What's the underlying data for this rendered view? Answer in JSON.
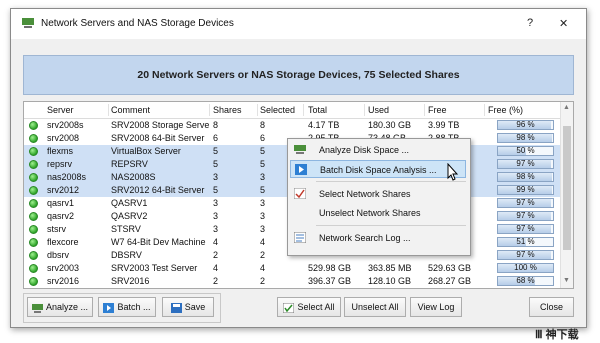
{
  "window": {
    "title": "Network Servers and NAS Storage Devices",
    "help_label": "?",
    "close_label": "✕"
  },
  "banner": {
    "text": "20 Network Servers or NAS Storage Devices, 75 Selected Shares"
  },
  "table": {
    "columns": [
      "Server",
      "Comment",
      "Shares",
      "Selected",
      "Total",
      "Used",
      "Free",
      "Free (%)"
    ],
    "rows": [
      {
        "server": "srv2008s",
        "comment": "SRV2008 Storage Server",
        "shares": "8",
        "selected": "8",
        "total": "4.17 TB",
        "used": "180.30 GB",
        "free": "3.99 TB",
        "free_pct": "96 %",
        "pct": 96,
        "selected_row": false
      },
      {
        "server": "srv2008",
        "comment": "SRV2008 64-Bit Server",
        "shares": "6",
        "selected": "6",
        "total": "2.95 TB",
        "used": "73.48 GB",
        "free": "2.88 TB",
        "free_pct": "98 %",
        "pct": 98,
        "selected_row": false
      },
      {
        "server": "flexms",
        "comment": "VirtualBox Server",
        "shares": "5",
        "selected": "5",
        "total": "",
        "used": "",
        "free": "",
        "free_pct": "50 %",
        "pct": 50,
        "selected_row": true
      },
      {
        "server": "repsrv",
        "comment": "REPSRV",
        "shares": "5",
        "selected": "5",
        "total": "",
        "used": "",
        "free": "",
        "free_pct": "97 %",
        "pct": 97,
        "selected_row": true
      },
      {
        "server": "nas2008s",
        "comment": "NAS2008S",
        "shares": "3",
        "selected": "3",
        "total": "",
        "used": "",
        "free": "",
        "free_pct": "98 %",
        "pct": 98,
        "selected_row": true
      },
      {
        "server": "srv2012",
        "comment": "SRV2012 64-Bit Server",
        "shares": "5",
        "selected": "5",
        "total": "",
        "used": "",
        "free": "",
        "free_pct": "99 %",
        "pct": 99,
        "selected_row": true
      },
      {
        "server": "qasrv1",
        "comment": "QASRV1",
        "shares": "3",
        "selected": "3",
        "total": "",
        "used": "",
        "free": "",
        "free_pct": "97 %",
        "pct": 97,
        "selected_row": false
      },
      {
        "server": "qasrv2",
        "comment": "QASRV2",
        "shares": "3",
        "selected": "3",
        "total": "",
        "used": "",
        "free": "",
        "free_pct": "97 %",
        "pct": 97,
        "selected_row": false
      },
      {
        "server": "stsrv",
        "comment": "STSRV",
        "shares": "3",
        "selected": "3",
        "total": "",
        "used": "",
        "free": "",
        "free_pct": "97 %",
        "pct": 97,
        "selected_row": false
      },
      {
        "server": "flexcore",
        "comment": "W7 64-Bit Dev Machine",
        "shares": "4",
        "selected": "4",
        "total": "",
        "used": "",
        "free": "",
        "free_pct": "51 %",
        "pct": 51,
        "selected_row": false
      },
      {
        "server": "dbsrv",
        "comment": "DBSRV",
        "shares": "2",
        "selected": "2",
        "total": "",
        "used": "",
        "free": "",
        "free_pct": "97 %",
        "pct": 97,
        "selected_row": false
      },
      {
        "server": "srv2003",
        "comment": "SRV2003 Test Server",
        "shares": "4",
        "selected": "4",
        "total": "529.98 GB",
        "used": "363.85 MB",
        "free": "529.63 GB",
        "free_pct": "100 %",
        "pct": 100,
        "selected_row": false
      },
      {
        "server": "srv2016",
        "comment": "SRV2016",
        "shares": "2",
        "selected": "2",
        "total": "396.37 GB",
        "used": "128.10 GB",
        "free": "268.27 GB",
        "free_pct": "68 %",
        "pct": 68,
        "selected_row": false
      },
      {
        "server": "",
        "comment": "",
        "shares": "",
        "selected": "",
        "total": "",
        "used": "",
        "free": "",
        "free_pct": "",
        "pct": 0,
        "selected_row": false
      }
    ]
  },
  "context_menu": {
    "items": [
      {
        "label": "Analyze Disk Space ...",
        "icon": "disk-space-icon"
      },
      {
        "label": "Batch Disk Space Analysis ...",
        "icon": "batch-play-icon"
      },
      {
        "label": "Select Network Shares",
        "icon": "checkmark-list-icon"
      },
      {
        "label": "Unselect Network Shares",
        "icon": ""
      },
      {
        "label": "Network Search Log ...",
        "icon": "log-icon"
      }
    ]
  },
  "buttons": {
    "analyze": "Analyze ...",
    "batch": "Batch ...",
    "save": "Save",
    "select_all": "Select All",
    "unselect_all": "Unselect All",
    "view_log": "View Log",
    "close": "Close"
  },
  "watermark": {
    "text": "Ⅲ 神下载"
  },
  "colors": {
    "selection": "#cfe0f5",
    "banner": "#c2d6ee",
    "highlight": "#cde4f7"
  }
}
